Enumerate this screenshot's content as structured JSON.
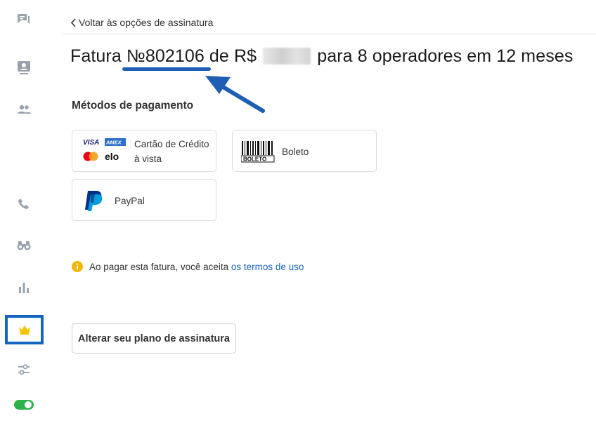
{
  "header": {
    "back_label": "Voltar às opções de assinatura",
    "title_prefix": "Fatura ",
    "invoice_number": "№802106",
    "title_mid": " de R$ ",
    "title_suffix": " para 8 operadores em 12 meses"
  },
  "payment": {
    "section_title": "Métodos de pagamento",
    "methods": [
      {
        "line1": "Cartão de Crédito",
        "line2": "à vista",
        "logos": [
          "VISA",
          "AMEX",
          "elo"
        ]
      },
      {
        "label": "Boleto",
        "logo_text": "BOLETO"
      },
      {
        "label": "PayPal"
      }
    ]
  },
  "notice": {
    "text": "Ao pagar esta fatura, você aceita",
    "link": "os termos de uso"
  },
  "plan_button": "Alterar seu plano de assinatura",
  "colors": {
    "accent_blue": "#1e5fb3",
    "link_blue": "#1a66c2",
    "crown_yellow": "#f5c400",
    "toggle_green": "#2ab34a",
    "info_yellow": "#f2b705"
  },
  "sidebar": {
    "items": [
      "chat-icon",
      "contact-card-icon",
      "people-icon",
      "phone-icon",
      "binoculars-icon",
      "bar-chart-icon",
      "crown-icon",
      "sliders-icon",
      "toggle-icon"
    ],
    "active": "crown-icon"
  }
}
